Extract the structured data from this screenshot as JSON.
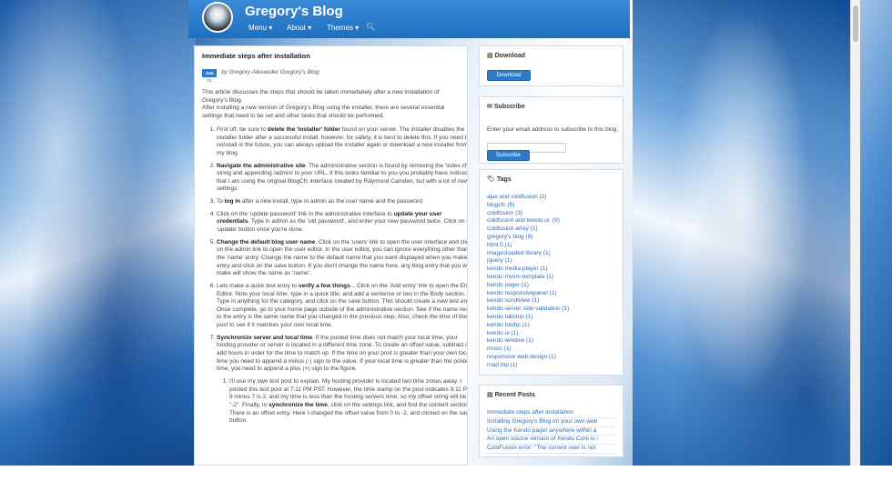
{
  "site": {
    "title": "Gregory's Blog"
  },
  "nav": {
    "items": [
      {
        "label": "Menu ▾"
      },
      {
        "label": "About ▾"
      },
      {
        "label": "Themes ▾"
      }
    ],
    "search_icon": "search-icon"
  },
  "post": {
    "title": "Immediate steps after installation",
    "date_month": "JUN",
    "date_day": "15",
    "byline": "by Gregory Alexander Gregory's Blog",
    "intro_1": "This article discusses the steps that should be taken immediately after a new installation of Gregory's Blog.",
    "intro_2": "After installing a new version of Gregory's Blog using the installer, there are several essential settings that need to be set and other tasks that should be performed.",
    "steps": [
      {
        "pre": "First off, be sure to ",
        "bold": "delete the 'installer' folder",
        "post": " found on your server. The installer disables the installer folder after a successful install, however, for safety, it is best to delete this. If you need to reinstall in the future, you can always upload the installer again or download a new installer from my blog."
      },
      {
        "pre": "",
        "bold": "Navigate the administrative site",
        "post": ". The administrative section is found by removing the 'index.cfm' string and appending /admin/ to your URL. If this looks familiar to you-you probably have noticed that I am using the original BlogCfc interface created by Raymond Camden, but with a lot of new settings."
      },
      {
        "pre": "To ",
        "bold": "log in",
        "post": " after a new install, type in admin as the user name and the password."
      },
      {
        "pre": "Click on the 'update password' link in the administrative interface to ",
        "bold": "update your user credentials",
        "post": ". Type in admin as the 'old password', and enter your new password twice. Click on the 'update' button once you're done."
      },
      {
        "pre": "",
        "bold": "Change the default blog user name",
        "post": ". Click on the 'users' link to open the user interface and click on the admin link to open the user editor. In the user editor, you can ignore everything other than the 'name' entry. Change the name to the default name that you want displayed when you make an entry and click on the save button. If you don't change the name here, any blog entry that you will make will show the name as 'name'."
      },
      {
        "pre": "Lets make a quick test entry to ",
        "bold": "verify a few things",
        "post": "... Click on the 'Add entry' link to open the Entry Editor. Note your local time, type in a quick title, and add a sentence or two in the Body section. Type in anything for the category, and click on the save button. This should create a new test entry. Once complete, go to your home page outside of the administrative section. See if the name next to the entry is the same name that you changed in the previous step. Also, check the time of the post to see if it matches your own local time."
      },
      {
        "pre": "",
        "bold": "Synchronize server and local time",
        "post": ". If the posted time does not match your local time, your hosting provider or server is located in a different time zone. To create an offset value, subtract or add hours in order for the time to match up. If the time on your post is greater than your own local time you need to append a minus (-) sign to the value. If your local time is greater than the posted time, you need to append a plus (+) sign to the figure."
      }
    ],
    "substep": {
      "pre": "I'll use my own test post to explain. My hosting provider is located two time zones away. I posted this test post at 7:11 PM PST. However, the time stamp on the post indicates 9:11 PM. 9 minus 7 is 2, and my time is less than the hosting servers time, so my offset string will be \"-2\". Finally, to ",
      "bold": "synchronize the time",
      "post": ", click on the settings link, and find the content section. There is an offset entry. Here I changed the offset value from 0 to -2, and clicked on the save button."
    }
  },
  "sidebar": {
    "download": {
      "title": "Download",
      "button": "Download"
    },
    "subscribe": {
      "title": "Subscribe",
      "text": "Enter your email address to subscribe to this blog.",
      "input_placeholder": "",
      "button": "Subscribe"
    },
    "tags": {
      "title": "Tags",
      "items": [
        "ajax and coldfusion (2)",
        "blogcfc (5)",
        "coldfusion (3)",
        "coldfusion and kendo ui. (9)",
        "coldfusion array (1)",
        "gregory's blog (8)",
        "html 5 (1)",
        "imagesloaded library (1)",
        "jquery (1)",
        "kendo media player (1)",
        "kendo mvvm template (1)",
        "kendo pager (1)",
        "kendo responsivepanel (1)",
        "kendo scrollview (1)",
        "kendo server side validation (1)",
        "kendo tabstrip (1)",
        "kendo tooltip (1)",
        "kendo ui (1)",
        "kendo window (1)",
        "music (1)",
        "responsive web design (1)",
        "road trip (1)"
      ]
    },
    "recent": {
      "title": "Recent Posts",
      "items": [
        "Immediate steps after installation",
        "Installing Gregory's Blog on your own web",
        "Using the Kendo pager anywhere within a",
        "An open source version of Kendo Core is i",
        "ColdFusion error: \"The current user is not"
      ]
    }
  },
  "colors": {
    "header": "#2d7bc8",
    "link": "#2d6cb5",
    "button": "#2d7bc8"
  }
}
